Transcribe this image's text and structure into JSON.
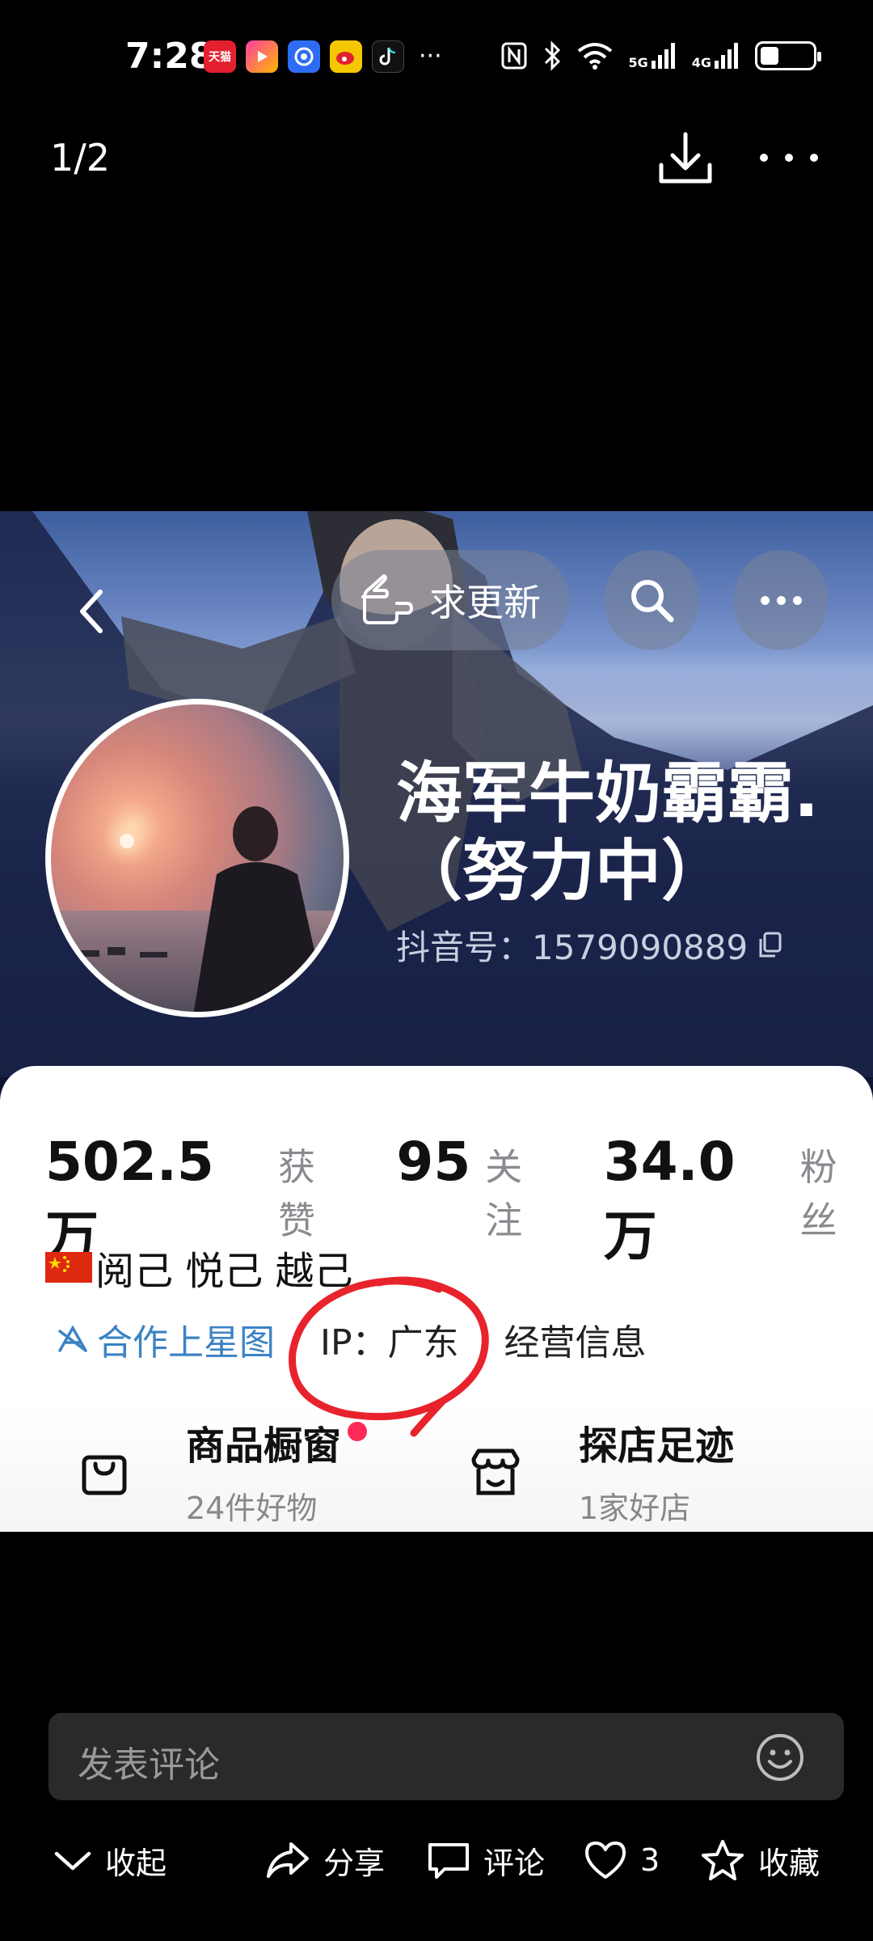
{
  "status_bar": {
    "time": "7:28",
    "network_1": "5G",
    "network_2": "4G",
    "battery_level": 0.35,
    "apps": [
      "天猫",
      "优酷",
      "百度",
      "微博",
      "抖音"
    ]
  },
  "header": {
    "page_counter": "1/2"
  },
  "embedded_screenshot": {
    "update_button_label": "求更新",
    "profile": {
      "name": "海军牛奶霸霸.（努力中）",
      "douyin_id": "抖音号：1579090889"
    },
    "stats": [
      {
        "value": "502.5万",
        "label": "获赞"
      },
      {
        "value": "95",
        "label": "关注"
      },
      {
        "value": "34.0万",
        "label": "粉丝"
      }
    ],
    "bio": "阅己 悦己 越己",
    "tags": {
      "star_label": "合作上星图",
      "ip_label": "IP：广东",
      "business_label": "经营信息"
    },
    "cards": [
      {
        "title": "商品橱窗",
        "subtitle": "24件好物"
      },
      {
        "title": "探店足迹",
        "subtitle": "1家好店"
      }
    ]
  },
  "comment": {
    "placeholder": "发表评论"
  },
  "actions": {
    "collapse": "收起",
    "share": "分享",
    "comment": "评论",
    "likes": "3",
    "favorite": "收藏"
  },
  "colors": {
    "accent_blue": "#3b82c4",
    "annotation_red": "#e8232c",
    "badge_red": "#ff2a55"
  }
}
